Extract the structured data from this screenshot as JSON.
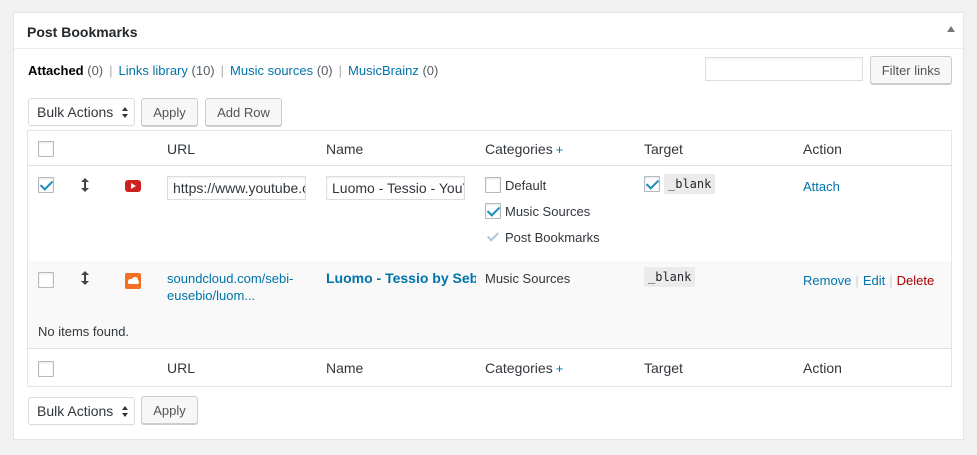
{
  "panel": {
    "title": "Post Bookmarks"
  },
  "views": [
    {
      "label": "Attached",
      "count": "(0)"
    },
    {
      "label": "Links library",
      "count": "(10)"
    },
    {
      "label": "Music sources",
      "count": "(0)"
    },
    {
      "label": "MusicBrainz",
      "count": "(0)"
    }
  ],
  "filter": {
    "value": "",
    "button": "Filter links"
  },
  "top_actions": {
    "bulk": "Bulk Actions",
    "apply": "Apply",
    "add_row": "Add Row"
  },
  "bottom_actions": {
    "bulk": "Bulk Actions",
    "apply": "Apply"
  },
  "columns": {
    "url": "URL",
    "name": "Name",
    "categories": "Categories",
    "categories_add": "+",
    "target": "Target",
    "action": "Action"
  },
  "rows": [
    {
      "checked": true,
      "icon": "youtube-icon",
      "url": "https://www.youtube.com/watch",
      "name": "Luomo - Tessio - YouTube",
      "categories": [
        {
          "label": "Default",
          "checked": false
        },
        {
          "label": "Music Sources",
          "checked": true
        },
        {
          "label": "Post Bookmarks",
          "checked": true,
          "disabled": true
        }
      ],
      "target": {
        "checked": true,
        "label": "_blank"
      },
      "action": "Attach"
    },
    {
      "checked": false,
      "icon": "soundcloud-icon",
      "url_line1": "soundcloud.com/sebi-",
      "url_line2": "eusebio/luom...",
      "name": "Luomo - Tessio by Sebi",
      "categories": "Music Sources",
      "target": "_blank",
      "actions": {
        "remove": "Remove",
        "edit": "Edit",
        "delete": "Delete"
      }
    }
  ],
  "empty_message": "No items found.",
  "colors": {
    "link": "#0073aa",
    "delete": "#aa0000",
    "youtube": "#cd201f",
    "soundcloud": "#f26f23"
  }
}
